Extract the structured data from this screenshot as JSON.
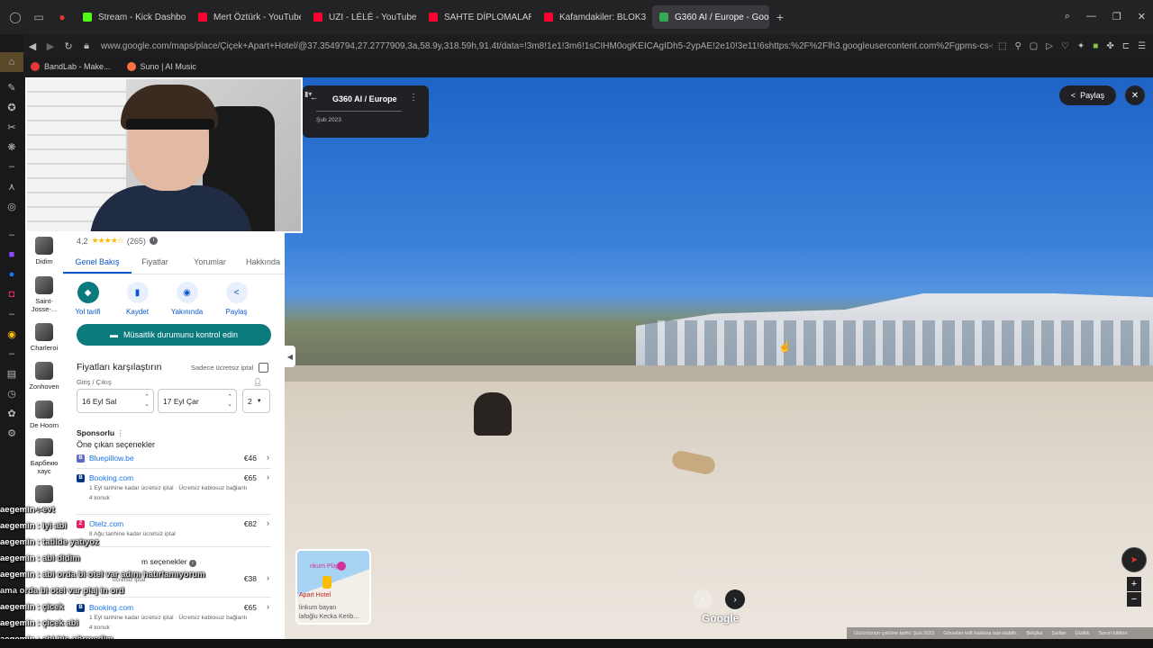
{
  "browser": {
    "tabs": [
      {
        "label": "Stream - Kick Dashboard",
        "color": "#53fc18",
        "active": false
      },
      {
        "label": "Mert Öztürk - YouTube",
        "color": "#ff0033",
        "active": false
      },
      {
        "label": "UZI - LÉLÉ - YouTube",
        "color": "#ff0033",
        "active": false
      },
      {
        "label": "SAHTE DİPLOMALAR İFŞ",
        "color": "#ff0033",
        "active": false
      },
      {
        "label": "Kafamdakiler: BLOK3 \"YA",
        "color": "#ff0033",
        "active": false
      },
      {
        "label": "G360 AI / Europe - Goog",
        "color": "#34a853",
        "active": true
      }
    ],
    "new_tab": "+",
    "url": "www.google.com/maps/place/Çiçek+Apart+Hotel/@37.3549794,27.2777909,3a,58.9y,318.59h,91.4t/data=!3m8!1e1!3m6!1sCIHM0ogKEICAgIDh5-2ypAE!2e10!3e11!6shttps:%2F%2Flh3.googleusercontent.com%2Fgpms-cs-s%2FAB8u6HaHm",
    "bookmarks": [
      {
        "label": "BandLab - Make...",
        "color": "#e53935"
      },
      {
        "label": "Suno | AI Music",
        "color": "#ff7043"
      }
    ]
  },
  "place": {
    "rating": "4,2",
    "stars": "★★★★☆",
    "review_count": "(265)",
    "tabs": [
      "Genel Bakış",
      "Fiyatlar",
      "Yorumlar",
      "Hakkında"
    ],
    "actions": [
      {
        "label": "Yol tarifi",
        "icon": "directions-icon"
      },
      {
        "label": "Kaydet",
        "icon": "bookmark-icon"
      },
      {
        "label": "Yakınında",
        "icon": "nearby-icon"
      },
      {
        "label": "Paylaş",
        "icon": "share-icon"
      }
    ],
    "availability_button": "Müsaitlik durumunu kontrol edin",
    "compare_title": "Fiyatları karşılaştırın",
    "free_cancel_label": "Sadece ücretsiz iptal",
    "checkin_label": "Giriş / Çıkış",
    "checkin": "16 Eyl Sal",
    "checkout": "17 Eyl Çar",
    "guests": "2",
    "sponsored": "Sponsorlu",
    "featured": "Öne çıkan seçenekler",
    "offers": [
      {
        "name": "Bluepillow.be",
        "price": "€46",
        "sub1": "",
        "sub2": "",
        "badge": "B",
        "color": "#5c6bc0"
      },
      {
        "name": "Booking.com",
        "price": "€65",
        "sub1": "1 Eyl tarihine kadar ücretsiz iptal · Ücretsiz kablosuz bağlantı",
        "sub2": "4 konuk",
        "badge": "B",
        "color": "#003580"
      },
      {
        "name": "Otelz.com",
        "price": "€82",
        "sub1": "8 Ağu tarihine kadar ücretsiz iptal",
        "sub2": "",
        "badge": "Z",
        "color": "#e91e63"
      },
      {
        "name": "",
        "price": "€38",
        "sub1": "ücretsiz iptal",
        "sub2": "",
        "badge": "",
        "color": "#0b7a7f"
      },
      {
        "name": "Booking.com",
        "price": "€65",
        "sub1": "1 Eyl tarihine kadar ücretsiz iptal · Ücretsiz kablosuz bağlantı",
        "sub2": "4 konuk",
        "badge": "B",
        "color": "#003580"
      }
    ],
    "all_options": "m seçenekler"
  },
  "leftnav": [
    {
      "label": "Didim"
    },
    {
      "label": "Saint-Josse-..."
    },
    {
      "label": "Charleroi"
    },
    {
      "label": "Zonhoven"
    },
    {
      "label": "De Hoorn"
    },
    {
      "label": "Барбекю хаус"
    },
    {
      "label": "Adası"
    }
  ],
  "streetview": {
    "title": "G360 AI / Europe",
    "date": "Şub 2023",
    "share": "Paylaş",
    "close": "✕",
    "google": "Google",
    "minimap_labels": [
      "nkum Plajı",
      "Apart Hotel",
      "linkum bayan",
      "lafoğlu Kecka Kerib..."
    ],
    "footer": [
      "Görüntünün çekilme tarihi: Şub 2023",
      "Görseller telif hakkına tabi olabilir.",
      "Belçika",
      "Şartlar",
      "Gizlilik",
      "Sorun bildirin"
    ]
  },
  "chat": [
    {
      "user": "aegemin",
      "msg": "evt"
    },
    {
      "user": "aegemin",
      "msg": "iyi abi"
    },
    {
      "user": "aegemin",
      "msg": "tatilde yatıyoz"
    },
    {
      "user": "aegemin",
      "msg": "abi didim"
    },
    {
      "user": "aegemin",
      "msg": "abi orda bi otel var adını hatırlamıyorum"
    },
    {
      "user": "",
      "msg": "ama orda bi otel var plaj in ord"
    },
    {
      "user": "aegemin",
      "msg": "çicek"
    },
    {
      "user": "aegemin",
      "msg": "çicek abi"
    },
    {
      "user": "aegemin",
      "msg": "abi hiç görmedim"
    }
  ]
}
